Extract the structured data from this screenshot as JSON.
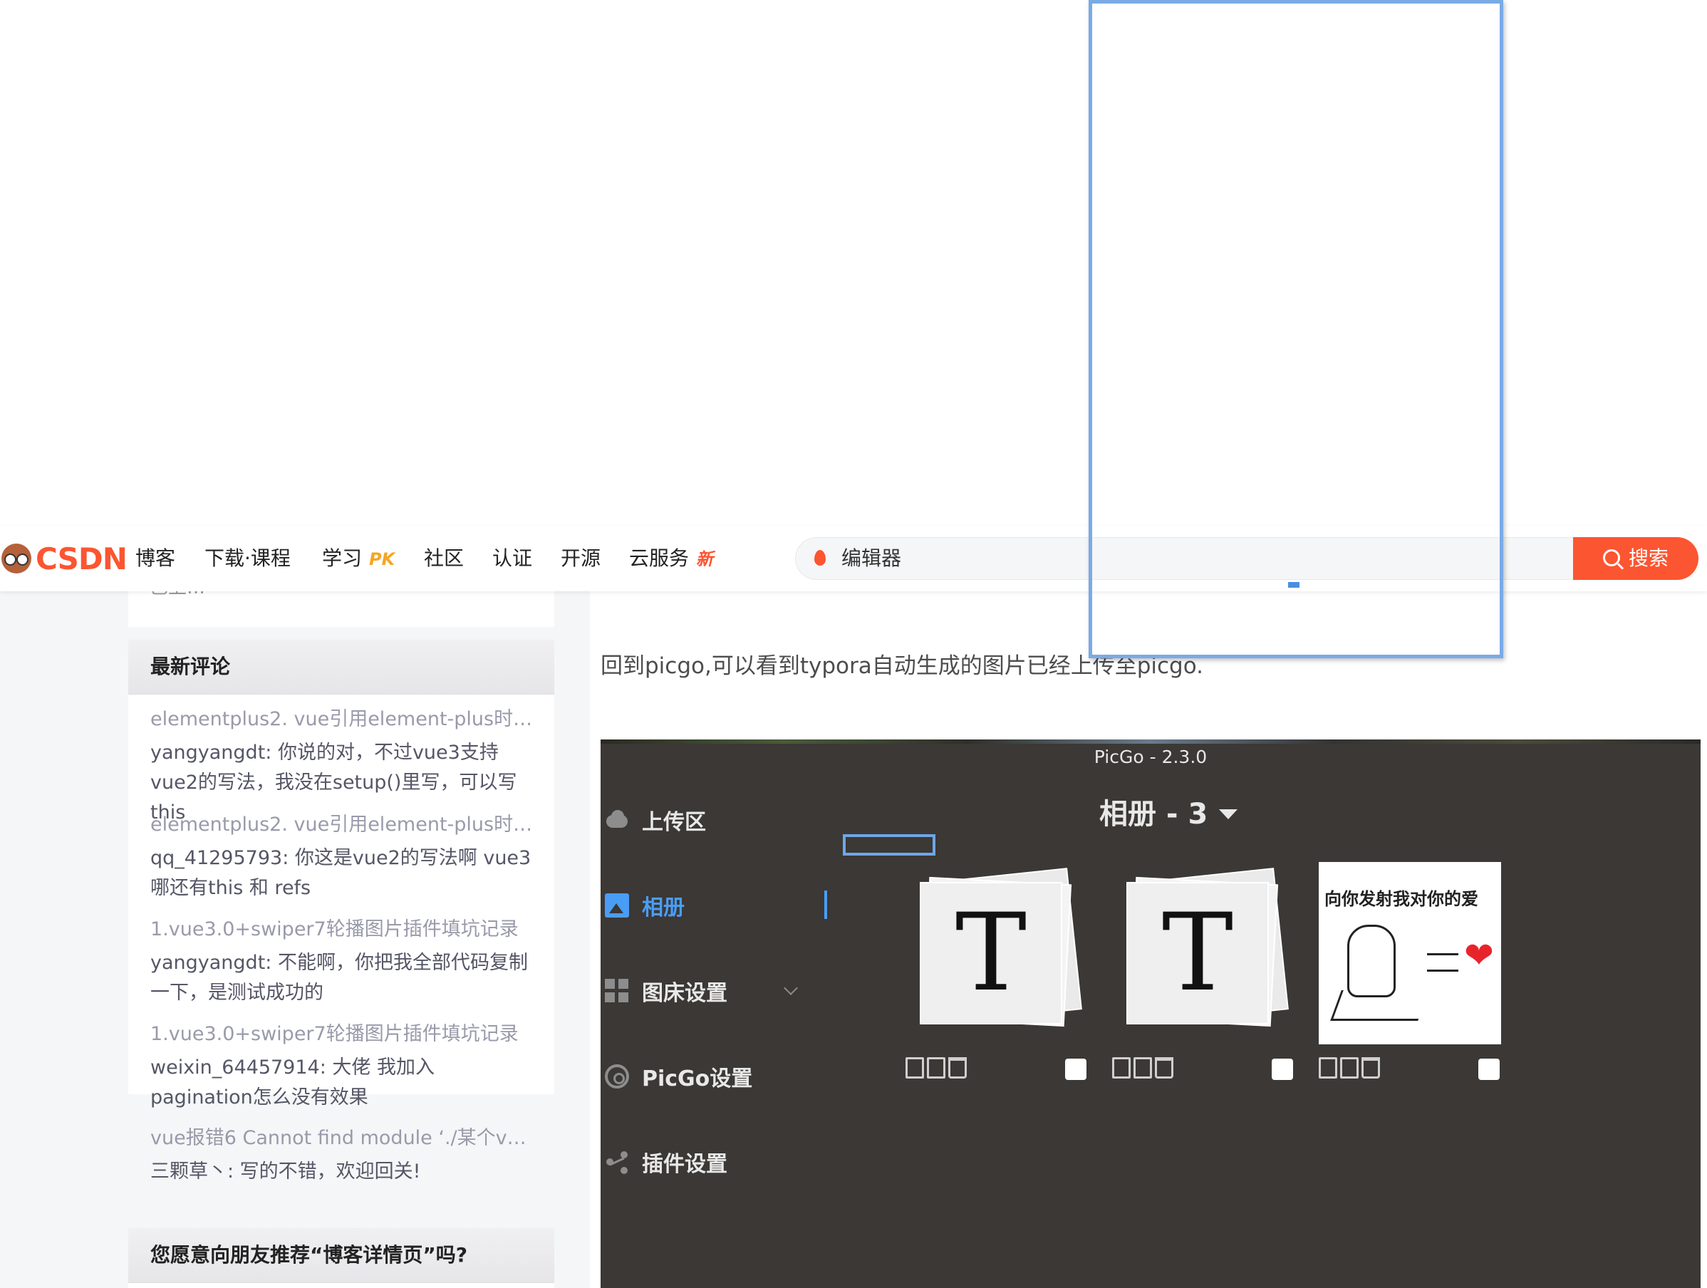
{
  "topbar": {
    "logo_text": "CSDN",
    "nav": [
      {
        "label": "博客"
      },
      {
        "label": "下载·课程"
      },
      {
        "label": "学习",
        "badge": "PK",
        "badge_color": "#f5a623"
      },
      {
        "label": "社区"
      },
      {
        "label": "认证"
      },
      {
        "label": "开源"
      },
      {
        "label": "云服务",
        "badge": "新",
        "badge_color": "#fc5531"
      }
    ],
    "search_query": "编辑器",
    "search_button": "搜索",
    "accent_color": "#fc5531"
  },
  "sidebar": {
    "stat_cut_text": "已上…",
    "comments_title": "最新评论",
    "comments": [
      {
        "source": "elementplus2. vue引用element-plus时清…",
        "text": "yangyangdt: 你说的对，不过vue3支持vue2的写法，我没在setup()里写，可以写this"
      },
      {
        "source": "elementplus2. vue引用element-plus时清…",
        "text": "qq_41295793: 你这是vue2的写法啊 vue3哪还有this 和 refs"
      },
      {
        "source": "1.vue3.0+swiper7轮播图片插件填坑记录",
        "text": "yangyangdt: 不能啊，你把我全部代码复制一下，是测试成功的"
      },
      {
        "source": "1.vue3.0+swiper7轮播图片插件填坑记录",
        "text": "weixin_64457914: 大佬 我加入pagination怎么没有效果"
      },
      {
        "source": "vue报错6 Cannot find module ‘./某个vue …",
        "text": "三颗草丶: 写的不错，欢迎回关!"
      }
    ],
    "recommend_title": "您愿意向朋友推荐“博客详情页”吗?"
  },
  "article": {
    "paragraph": "回到picgo,可以看到typora自动生成的图片已经上传至picgo."
  },
  "picgo": {
    "window_title": "PicGo - 2.3.0",
    "menu": [
      {
        "label": "上传区",
        "icon": "cloud-upload-icon"
      },
      {
        "label": "相册",
        "icon": "image-icon",
        "active": true
      },
      {
        "label": "图床设置",
        "icon": "grid-icon"
      },
      {
        "label": "PicGo设置",
        "icon": "gear-icon"
      },
      {
        "label": "插件设置",
        "icon": "share-icon"
      }
    ],
    "album_title": "相册 - 3",
    "thumbs": [
      {
        "glyph": "T"
      },
      {
        "glyph": "T"
      },
      {
        "caption": "向你发射我对你的爱",
        "glyph": "❤"
      }
    ],
    "active_color": "#4a9df5"
  }
}
